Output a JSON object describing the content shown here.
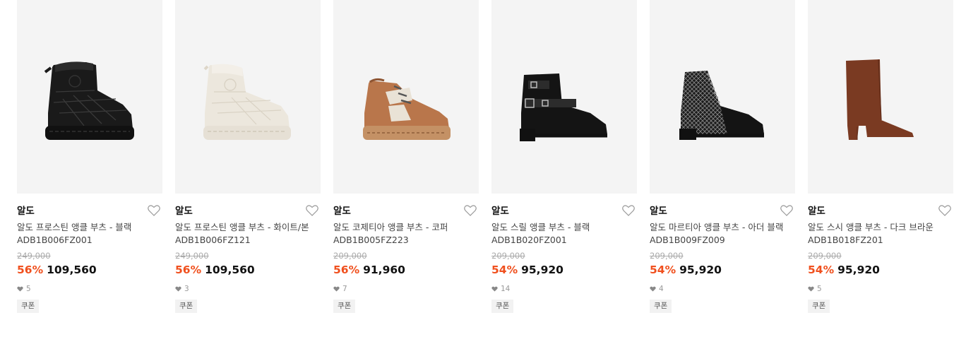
{
  "products": [
    {
      "brand": "알도",
      "name": "알도 프로스틴 앵클 부츠 - 블랙",
      "sku": "ADB1B006FZ001",
      "original_price": "249,000",
      "discount": "56%",
      "price": "109,560",
      "likes": "5",
      "badge": "쿠폰",
      "image": "black-quilted-snow-boot"
    },
    {
      "brand": "알도",
      "name": "알도 프로스틴 앵클 부츠 - 화이트/본",
      "sku": "ADB1B006FZ121",
      "original_price": "249,000",
      "discount": "56%",
      "price": "109,560",
      "likes": "3",
      "badge": "쿠폰",
      "image": "white-quilted-snow-boot"
    },
    {
      "brand": "알도",
      "name": "알도 코제티아 앵클 부츠 - 코퍼",
      "sku": "ADB1B005FZ223",
      "original_price": "209,000",
      "discount": "56%",
      "price": "91,960",
      "likes": "7",
      "badge": "쿠폰",
      "image": "copper-hiking-boot"
    },
    {
      "brand": "알도",
      "name": "알도 스릴 앵클 부츠 - 블랙",
      "sku": "ADB1B020FZ001",
      "original_price": "209,000",
      "discount": "54%",
      "price": "95,920",
      "likes": "14",
      "badge": "쿠폰",
      "image": "black-buckle-moto-boot"
    },
    {
      "brand": "알도",
      "name": "알도 마르티아 앵클 부츠 - 아더 블랙",
      "sku": "ADB1B009FZ009",
      "original_price": "209,000",
      "discount": "54%",
      "price": "95,920",
      "likes": "4",
      "badge": "쿠폰",
      "image": "tweed-lace-up-boot"
    },
    {
      "brand": "알도",
      "name": "알도 스시 앵클 부츠 - 다크 브라운",
      "sku": "ADB1B018FZ201",
      "original_price": "209,000",
      "discount": "54%",
      "price": "95,920",
      "likes": "5",
      "badge": "쿠폰",
      "image": "brown-suede-heel-boot"
    }
  ],
  "colors": {
    "discount": "#f0501e",
    "image_bg": "#f4f4f4",
    "muted": "#999999"
  }
}
